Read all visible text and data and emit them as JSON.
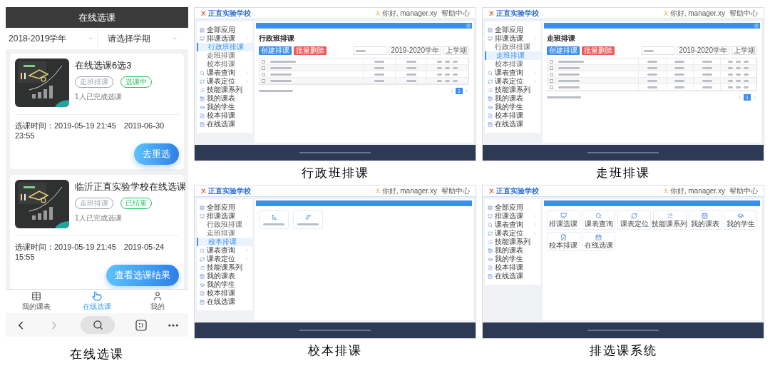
{
  "phone": {
    "title": "在线选课",
    "filters": [
      {
        "value": "2018-2019学年"
      },
      {
        "value": "请选择学期"
      }
    ],
    "courses": [
      {
        "title": "在线选课6选3",
        "tags": [
          {
            "label": "走班排课",
            "color": "#9ca3af"
          },
          {
            "label": "选课中",
            "color": "#22c55e"
          }
        ],
        "completed": "1人已完成选课",
        "time_label": "选课时间：",
        "start": "2019-05-19 21:45",
        "end": "2019-06-30 23:55",
        "action": "去重选"
      },
      {
        "title": "临沂正直实验学校在线选课",
        "tags": [
          {
            "label": "走班排课",
            "color": "#9ca3af"
          },
          {
            "label": "已结束",
            "color": "#22c55e"
          }
        ],
        "completed": "1人已完成选课",
        "time_label": "选课时间：",
        "start": "2019-05-19 21:45",
        "end": "2019-05-24 15:55",
        "action": "查看选课结果"
      }
    ],
    "tab_bar": [
      {
        "label": "我的课表",
        "selected": false
      },
      {
        "label": "在线选课",
        "selected": true
      },
      {
        "label": "我的",
        "selected": false
      }
    ],
    "caption": "在线选课"
  },
  "screens": [
    {
      "kind": "table",
      "school": "正直实验学校",
      "greeting": "你好, manager.xy",
      "help": "帮助中心",
      "title": "行政班排课",
      "buttons": [
        {
          "label": "创建排课",
          "color": "#3b8ff0"
        },
        {
          "label": "批量删除",
          "color": "#f05a5a"
        }
      ],
      "selects": [
        {
          "value": "2019-2020学年"
        },
        {
          "value": "上学期"
        }
      ],
      "sidebar": [
        {
          "label": "全部应用",
          "selected": false
        },
        {
          "label": "排课选课",
          "selected": false,
          "expanded": true,
          "children": [
            {
              "label": "行政班排课",
              "selected": true
            },
            {
              "label": "走班排课",
              "selected": false
            },
            {
              "label": "校本排课",
              "selected": false
            }
          ]
        },
        {
          "label": "课表查询",
          "selected": false,
          "expanded": false
        },
        {
          "label": "课表定位",
          "selected": false,
          "expanded": false
        },
        {
          "label": "技能课系列",
          "selected": false
        },
        {
          "label": "我的课表",
          "selected": false
        },
        {
          "label": "我的学生",
          "selected": false
        },
        {
          "label": "校本排课",
          "selected": false
        },
        {
          "label": "在线选课",
          "selected": false
        }
      ],
      "table": {
        "select_all": {
          "checked": false
        },
        "columns": [
          {
            "kind": "checkbox"
          },
          {
            "kind": "wide"
          },
          {
            "kind": "text"
          },
          {
            "kind": "text"
          },
          {
            "kind": "actions"
          }
        ],
        "rows": [
          {
            "checked": false
          },
          {
            "checked": false
          },
          {
            "checked": false
          }
        ]
      },
      "pages": [
        {
          "label": "1",
          "selected": true
        }
      ],
      "caption": "行政班排课"
    },
    {
      "kind": "table",
      "school": "正直实验学校",
      "greeting": "你好, manager.xy",
      "help": "帮助中心",
      "title": "走班排课",
      "buttons": [
        {
          "label": "创建排课",
          "color": "#3b8ff0"
        },
        {
          "label": "批量删除",
          "color": "#f05a5a"
        }
      ],
      "selects": [
        {
          "value": "2019-2020学年"
        },
        {
          "value": "上学期"
        }
      ],
      "sidebar": [
        {
          "label": "全部应用",
          "selected": false
        },
        {
          "label": "排课选课",
          "selected": false,
          "expanded": true,
          "children": [
            {
              "label": "行政班排课",
              "selected": false
            },
            {
              "label": "走班排课",
              "selected": true
            },
            {
              "label": "校本排课",
              "selected": false
            }
          ]
        },
        {
          "label": "课表查询",
          "selected": false,
          "expanded": false
        },
        {
          "label": "课表定位",
          "selected": false,
          "expanded": false
        },
        {
          "label": "技能课系列",
          "selected": false
        },
        {
          "label": "我的课表",
          "selected": false
        },
        {
          "label": "我的学生",
          "selected": false
        },
        {
          "label": "校本排课",
          "selected": false
        },
        {
          "label": "在线选课",
          "selected": false
        }
      ],
      "table": {
        "select_all": {
          "checked": false
        },
        "columns": [
          {
            "kind": "checkbox"
          },
          {
            "kind": "wide"
          },
          {
            "kind": "text"
          },
          {
            "kind": "text"
          },
          {
            "kind": "text"
          },
          {
            "kind": "actions"
          }
        ],
        "rows": [
          {
            "checked": false
          },
          {
            "checked": false
          },
          {
            "checked": false
          },
          {
            "checked": false
          }
        ]
      },
      "pages": [
        {
          "label": "1",
          "selected": true
        }
      ],
      "caption": "走班排课"
    },
    {
      "kind": "sort",
      "school": "正直实验学校",
      "greeting": "你好, manager.xy",
      "help": "帮助中心",
      "sidebar": [
        {
          "label": "全部应用",
          "selected": false
        },
        {
          "label": "排课选课",
          "selected": false,
          "expanded": true,
          "children": [
            {
              "label": "行政班排课",
              "selected": false
            },
            {
              "label": "走班排课",
              "selected": false
            },
            {
              "label": "校本排课",
              "selected": true
            }
          ]
        },
        {
          "label": "课表查询",
          "selected": false,
          "expanded": false
        },
        {
          "label": "课表定位",
          "selected": false,
          "expanded": false
        },
        {
          "label": "技能课系列",
          "selected": false
        },
        {
          "label": "我的课表",
          "selected": false
        },
        {
          "label": "我的学生",
          "selected": false
        },
        {
          "label": "校本排课",
          "selected": false
        },
        {
          "label": "在线选课",
          "selected": false
        }
      ],
      "tiles": [
        {
          "kind": "ascending"
        },
        {
          "kind": "descending"
        }
      ],
      "caption": "校本排课"
    },
    {
      "kind": "tiles",
      "school": "正直实验学校",
      "greeting": "你好, manager.xy",
      "help": "帮助中心",
      "sidebar": [
        {
          "label": "全部应用",
          "selected": false
        },
        {
          "label": "排课选课",
          "selected": false,
          "expanded": false
        },
        {
          "label": "课表查询",
          "selected": false,
          "expanded": false
        },
        {
          "label": "课表定位",
          "selected": false,
          "expanded": false
        },
        {
          "label": "技能课系列",
          "selected": false
        },
        {
          "label": "我的课表",
          "selected": false
        },
        {
          "label": "我的学生",
          "selected": false
        },
        {
          "label": "校本排课",
          "selected": false
        },
        {
          "label": "在线选课",
          "selected": false
        }
      ],
      "tiles": [
        {
          "label": "排课选课"
        },
        {
          "label": "课表查询"
        },
        {
          "label": "课表定位"
        },
        {
          "label": "技能课系列"
        },
        {
          "label": "我的课表"
        },
        {
          "label": "我的学生"
        },
        {
          "label": "校本排课"
        },
        {
          "label": "在线选课"
        }
      ],
      "caption": "排选课系统"
    }
  ]
}
